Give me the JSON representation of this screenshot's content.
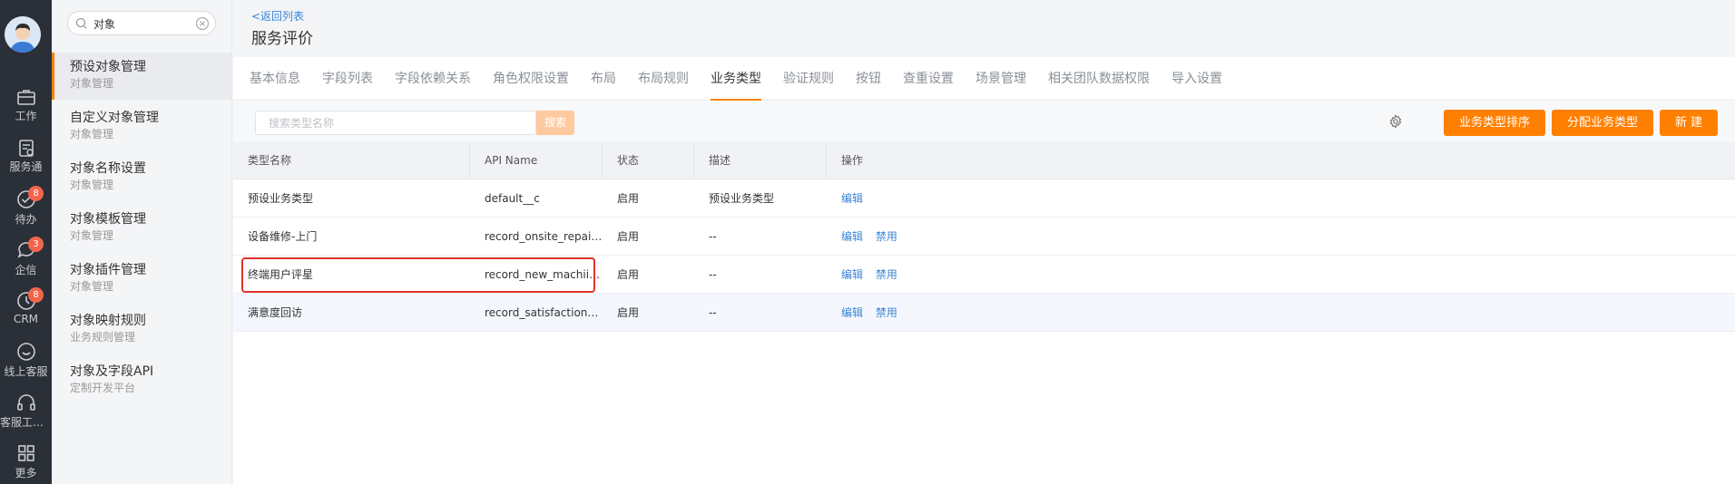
{
  "nav": {
    "items": [
      {
        "label": "工作",
        "icon": "briefcase-icon"
      },
      {
        "label": "服务通",
        "icon": "service-clipboard-icon"
      },
      {
        "label": "待办",
        "icon": "check-circle-icon",
        "badge": "8"
      },
      {
        "label": "企信",
        "icon": "chat-bubble-icon",
        "badge": "3"
      },
      {
        "label": "CRM",
        "icon": "clock-icon",
        "badge": "8"
      },
      {
        "label": "线上客服",
        "icon": "smile-icon"
      },
      {
        "label": "客服工作台",
        "icon": "headset-icon"
      },
      {
        "label": "更多",
        "icon": "grid-icon"
      }
    ]
  },
  "sidebar": {
    "search_value": "对象",
    "items": [
      {
        "title": "预设对象管理",
        "sub": "对象管理"
      },
      {
        "title": "自定义对象管理",
        "sub": "对象管理"
      },
      {
        "title": "对象名称设置",
        "sub": "对象管理"
      },
      {
        "title": "对象模板管理",
        "sub": "对象管理"
      },
      {
        "title": "对象插件管理",
        "sub": "对象管理"
      },
      {
        "title": "对象映射规则",
        "sub": "业务规则管理"
      },
      {
        "title": "对象及字段API",
        "sub": "定制开发平台"
      }
    ]
  },
  "header": {
    "back": "<返回列表",
    "title": "服务评价"
  },
  "tabs": [
    "基本信息",
    "字段列表",
    "字段依赖关系",
    "角色权限设置",
    "布局",
    "布局规则",
    "业务类型",
    "验证规则",
    "按钮",
    "查重设置",
    "场景管理",
    "相关团队数据权限",
    "导入设置"
  ],
  "active_tab": "业务类型",
  "toolbar": {
    "search_placeholder": "搜索类型名称",
    "search_button": "搜索",
    "sort_button": "业务类型排序",
    "assign_button": "分配业务类型",
    "new_button": "新 建"
  },
  "table": {
    "columns": [
      "类型名称",
      "API Name",
      "状态",
      "描述",
      "操作"
    ],
    "rows": [
      {
        "name": "预设业务类型",
        "api": "default__c",
        "status": "启用",
        "desc": "预设业务类型",
        "actions": [
          "编辑"
        ]
      },
      {
        "name": "设备维修-上门",
        "api": "record_onsite_repair…",
        "status": "启用",
        "desc": "--",
        "actions": [
          "编辑",
          "禁用"
        ]
      },
      {
        "name": "终端用户评星",
        "api": "record_new_machiin…",
        "status": "启用",
        "desc": "--",
        "actions": [
          "编辑",
          "禁用"
        ]
      },
      {
        "name": "满意度回访",
        "api": "record_satisfaction__c",
        "status": "启用",
        "desc": "--",
        "actions": [
          "编辑",
          "禁用"
        ]
      }
    ]
  },
  "colors": {
    "accent": "#ff8000",
    "link": "#3a86d6",
    "nav_bg": "#2b3038",
    "highlight_box": "#e0322a"
  }
}
